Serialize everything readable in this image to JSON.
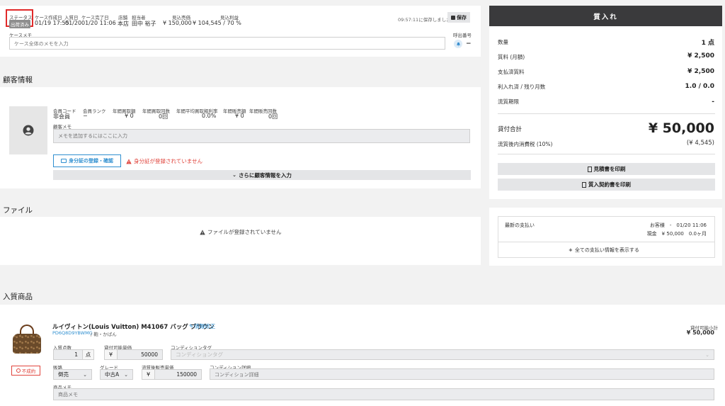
{
  "header": {
    "col_labels": [
      "ステータス",
      "ケース作成日",
      "入質日",
      "ケース完了日",
      "店舗",
      "担当者",
      "見込売価",
      "見込利益"
    ],
    "status_badge": "出荷済み",
    "created": "01/19 17:55",
    "pawn_date": "01/20",
    "completed": "01/20 11:06",
    "store": "本店",
    "staff": "田中 裕子",
    "expected_price": "¥ 150,000",
    "expected_profit": "¥ 104,545 / 70 %",
    "saved_text": "09:57:11に保存しました",
    "save_label": "保存",
    "case_memo_label": "ケースメモ",
    "case_memo_placeholder": "ケース全体のメモを入力",
    "call_number_label": "呼出番号",
    "call_number_value": "−"
  },
  "customer": {
    "title": "顧客情報",
    "stat_labels": [
      "会員コード",
      "会員ランク",
      "年間買取額",
      "年間買取回数",
      "年間平均買取粗利率",
      "年間販売額",
      "年間販売回数"
    ],
    "stat_values": [
      "非会員",
      "−",
      "¥ 0",
      "0回",
      "0.0%",
      "¥ 0",
      "0回"
    ],
    "memo_label": "顧客メモ",
    "memo_placeholder": "メモを追加するにはここに入力",
    "id_button": "身分証の登録・確認",
    "id_warning": "身分証が登録されていません",
    "more_button": "さらに顧客情報を入力"
  },
  "files": {
    "title": "ファイル",
    "empty": "ファイルが登録されていません"
  },
  "products": {
    "title": "入質商品",
    "item": {
      "name": "ルイヴィトン(Louis Vuitton) M41067 バッグ ブラウン",
      "edit_link": "情報修正",
      "code": "PD6Q8D9YBWMG",
      "category": "/ 鞄・かばん",
      "loan_subtotal_label": "貸付可能小計",
      "loan_subtotal": "¥ 50,000",
      "qty_label": "入質点数",
      "qty": "1",
      "qty_unit": "点",
      "loan_unit_label": "貸付可能単価",
      "loan_unit_prefix": "¥",
      "loan_unit": "50000",
      "cond_tag_label": "コンディションタグ",
      "cond_tag_placeholder": "コンディションタグ",
      "route_label": "販路",
      "route": "倒売",
      "grade_label": "グレード",
      "grade": "中古A",
      "sale_price_label": "流質後販売単価",
      "sale_price_prefix": "¥",
      "sale_price": "150000",
      "cond_detail_label": "コンディション詳細",
      "cond_detail_placeholder": "コンディション詳細",
      "memo_label": "商品メモ",
      "memo_placeholder": "商品メモ",
      "fail_button": "不成約"
    }
  },
  "sidebar": {
    "title": "質入れ",
    "rows": [
      {
        "k": "数量",
        "v": "1 点"
      },
      {
        "k": "質料 (月額)",
        "v": "¥ 2,500"
      },
      {
        "k": "支払済質料",
        "v": "¥ 2,500"
      },
      {
        "k": "利入れ済 / 残り月数",
        "v": "1.0 / 0.0"
      },
      {
        "k": "流質期限",
        "v": "-"
      }
    ],
    "total_label": "貸付合計",
    "total_value": "¥ 50,000",
    "tax_label": "流質後内消費税 (10%)",
    "tax_value": "(¥ 4,545)",
    "print_estimate": "見積書を印刷",
    "print_contract": "質入契約書を印刷",
    "payment_label": "最新の支払い",
    "payment_who": "お客様　-　01/20 11:06",
    "payment_detail": "現金　¥ 50,000　0.0ヶ月",
    "payment_all": "全ての支払い情報を表示する"
  },
  "colors": {
    "accent_blue": "#2f8fd0",
    "warning_red": "#e0443c",
    "dark_header": "#3a3a3c"
  }
}
